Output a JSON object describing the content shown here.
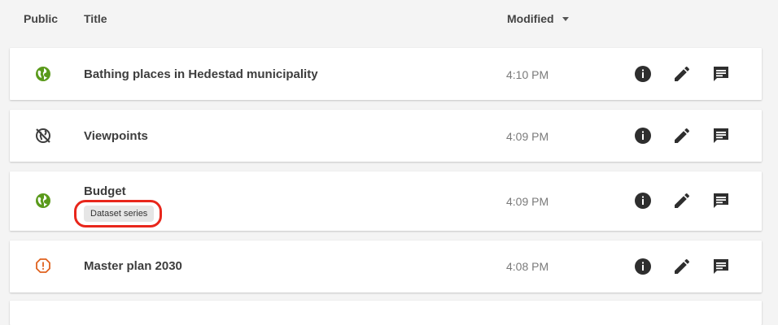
{
  "header": {
    "public_label": "Public",
    "title_label": "Title",
    "modified_label": "Modified"
  },
  "rows": [
    {
      "title": "Bathing places in Hedestad municipality",
      "modified": "4:10 PM",
      "status": "public-globe-icon"
    },
    {
      "title": "Viewpoints",
      "modified": "4:09 PM",
      "status": "not-public-globe-icon"
    },
    {
      "title": "Budget",
      "modified": "4:09 PM",
      "status": "public-globe-icon",
      "badge": "Dataset series"
    },
    {
      "title": "Master plan 2030",
      "modified": "4:08 PM",
      "status": "warning-icon"
    }
  ],
  "colors": {
    "public": "#5a9a1b",
    "not_public": "#3e3e3e",
    "warning": "#e0621f",
    "highlight": "#e8261b",
    "action_icon": "#2e2e2e"
  },
  "actions": [
    "info-icon",
    "edit-icon",
    "comment-icon"
  ]
}
